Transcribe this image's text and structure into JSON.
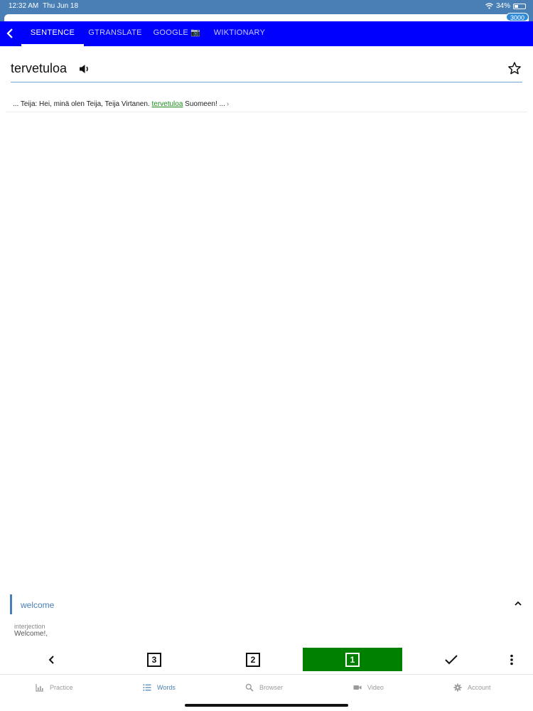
{
  "status_bar": {
    "time": "12:32 AM",
    "date": "Thu Jun 18",
    "battery": "34%"
  },
  "url_strip": {
    "count": "3000"
  },
  "tabs": [
    {
      "label": "SENTENCE",
      "active": true
    },
    {
      "label": "GTRANSLATE",
      "active": false
    },
    {
      "label": "GOOGLE 📷",
      "active": false
    },
    {
      "label": "WIKTIONARY",
      "active": false
    }
  ],
  "word": "tervetuloa",
  "sentence": {
    "prefix": "... Teija:  Hei, minä olen Teija, Teija Virtanen. ",
    "highlight": "tervetuloa",
    "suffix": " Suomeen! ..."
  },
  "translation": {
    "text": "welcome",
    "part_of_speech": "interjection",
    "definition": "Welcome!,"
  },
  "rating": {
    "buttons": [
      "3",
      "2",
      "1"
    ],
    "selected": "1"
  },
  "nav": [
    {
      "label": "Practice",
      "icon": "bar-chart-icon",
      "active": false
    },
    {
      "label": "Words",
      "icon": "list-icon",
      "active": true
    },
    {
      "label": "Browser",
      "icon": "search-icon",
      "active": false
    },
    {
      "label": "Video",
      "icon": "video-camera-icon",
      "active": false
    },
    {
      "label": "Account",
      "icon": "gear-icon",
      "active": false
    }
  ],
  "colors": {
    "tab_bar": "#0000ff",
    "selected_rating": "#008000",
    "accent": "#4a7fb5",
    "highlight_word": "#1b8a1b"
  }
}
